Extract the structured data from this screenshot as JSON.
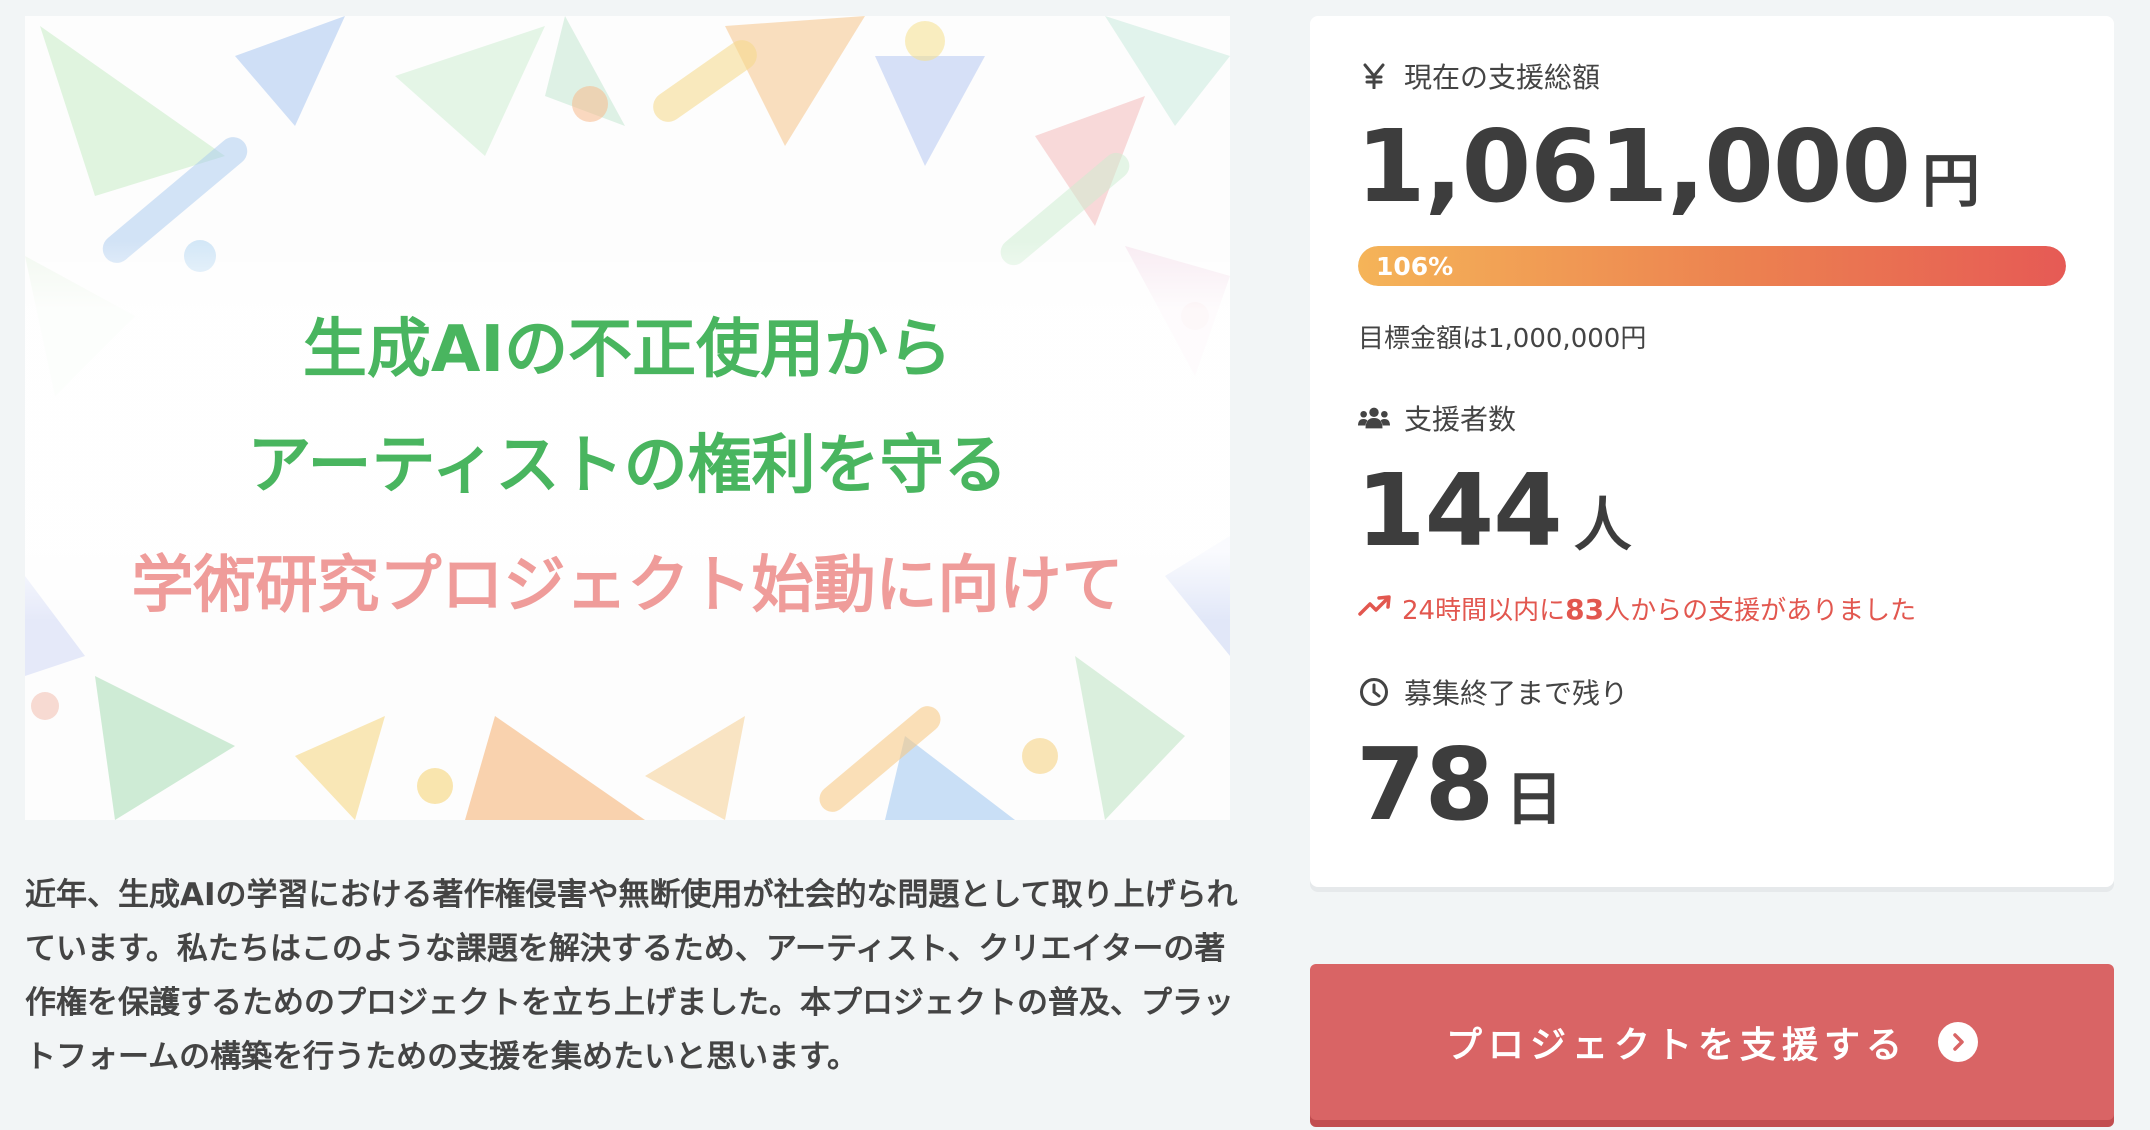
{
  "hero": {
    "line1": "生成AIの不正使用から",
    "line2": "アーティストの権利を守る",
    "line3": "学術研究プロジェクト始動に向けて"
  },
  "description": "近年、生成AIの学習における著作権侵害や無断使用が社会的な問題として取り上げられています。私たちはこのような課題を解決するため、アーティスト、クリエイターの著作権を保護するためのプロジェクトを立ち上げました。本プロジェクトの普及、プラットフォームの構築を行うための支援を集めたいと思います。",
  "stats": {
    "total_label": "現在の支援総額",
    "total_value": "1,061,000",
    "total_unit": "円",
    "progress_label": "106%",
    "progress_fraction": 1.06,
    "goal_text": "目標金額は1,000,000円",
    "supporters_label": "支援者数",
    "supporters_value": "144",
    "supporters_unit": "人",
    "recent_prefix": "24時間以内に",
    "recent_count": "83",
    "recent_suffix": "人からの支援がありました",
    "remaining_label": "募集終了まで残り",
    "remaining_value": "78",
    "remaining_unit": "日"
  },
  "cta": {
    "label": "プロジェクトを支援する"
  },
  "colors": {
    "accent_red": "#d96465",
    "trend_red": "#e2574f",
    "green_text": "#49b55f",
    "pink_text": "#ef9c9a"
  },
  "icons": {
    "yen": "yen-icon",
    "people": "people-icon",
    "trend": "trending-up-icon",
    "clock": "clock-icon",
    "arrow": "chevron-right-circle-icon"
  }
}
